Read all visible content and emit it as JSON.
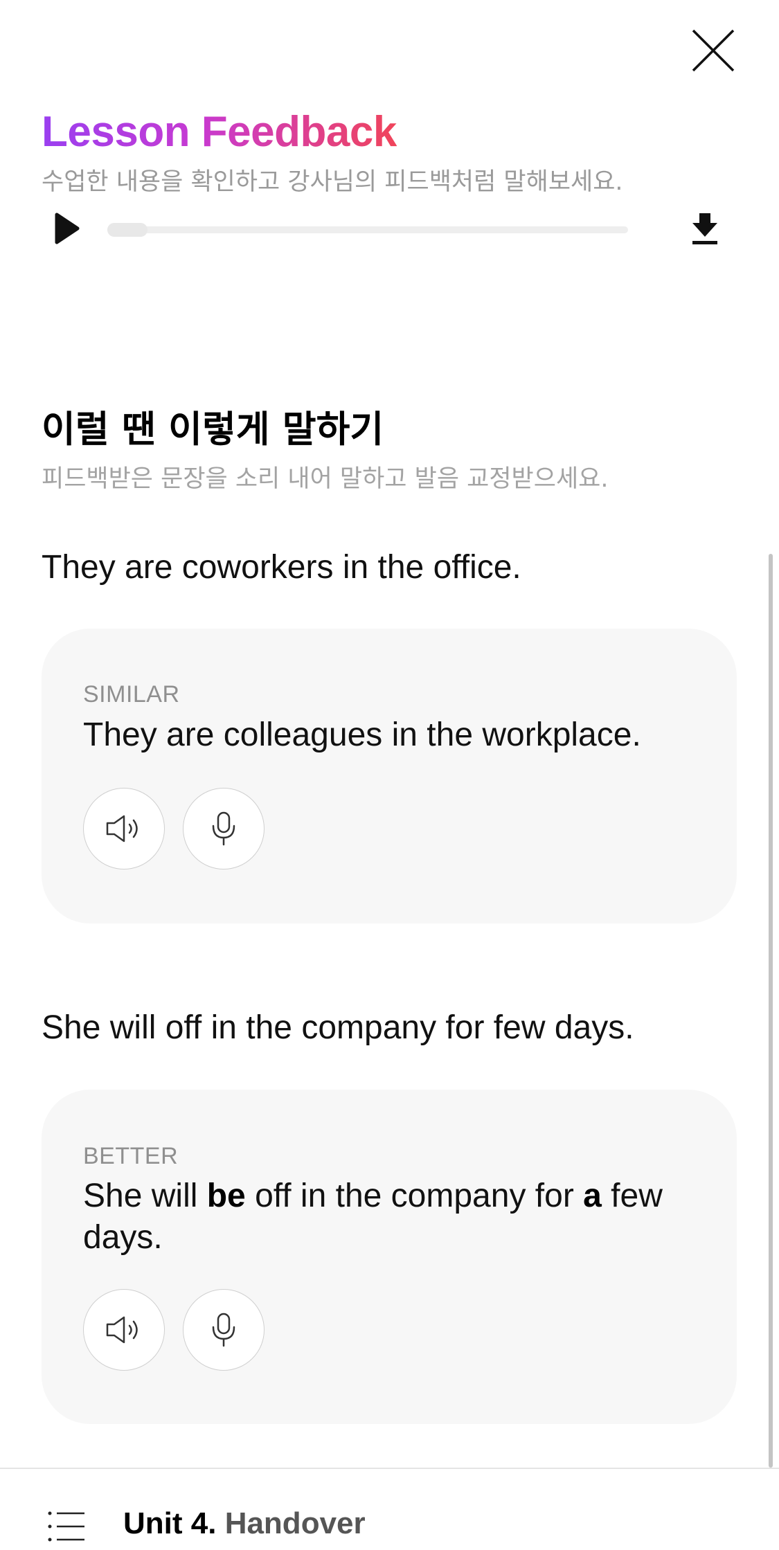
{
  "header": {
    "close_icon": "close-icon",
    "title": "Lesson Feedback",
    "subtitle": "수업한 내용을 확인하고 강사님의 피드백처럼 말해보세요."
  },
  "audio_player": {
    "play_icon": "play-icon",
    "download_icon": "download-icon",
    "progress": 0.0
  },
  "section": {
    "title": "이럴 땐 이렇게 말하기",
    "subtitle": "피드백받은 문장을 소리 내어 말하고 발음 교정받으세요."
  },
  "feedback_items": [
    {
      "original": "They are coworkers in the office.",
      "label": "SIMILAR",
      "suggestion": "They are colleagues in the workplace."
    },
    {
      "original": "She will off in the company for few days.",
      "label": "BETTER",
      "suggestion_parts": {
        "p1": "She will ",
        "b1": "be",
        "p2": " off in the company for ",
        "b2": "a",
        "p3": " few days."
      }
    }
  ],
  "bottom_bar": {
    "menu_icon": "list-menu-icon",
    "unit_number": "Unit 4.",
    "unit_title": "Handover"
  }
}
